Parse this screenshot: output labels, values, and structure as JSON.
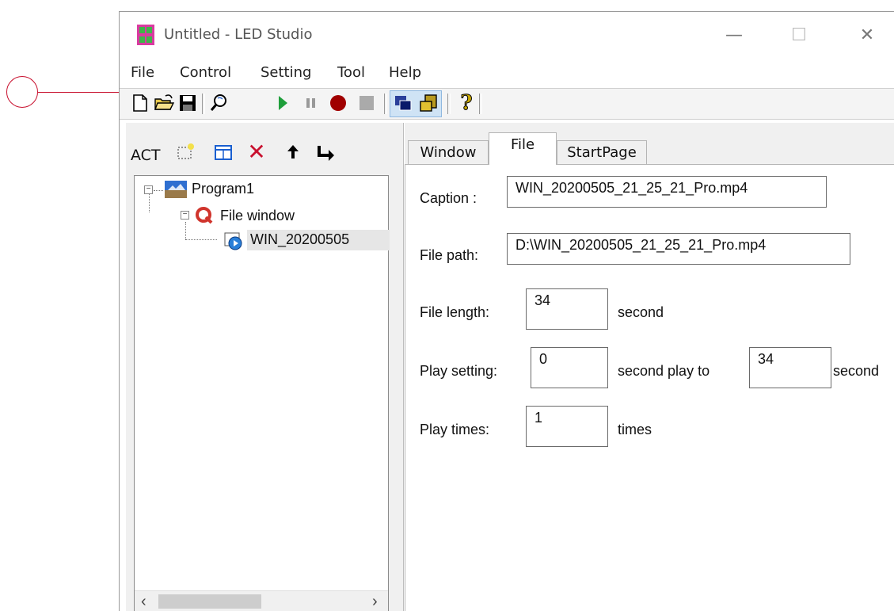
{
  "window": {
    "title": "Untitled - LED Studio",
    "min_glyph": "—",
    "max_glyph": "☐",
    "close_glyph": "✕"
  },
  "menu": [
    "File",
    "Control",
    "Setting",
    "Tool",
    "Help"
  ],
  "toolbar": {
    "icons": [
      "new-file-icon",
      "open-folder-icon",
      "save-icon",
      "preview-icon",
      "play-icon",
      "pause-icon",
      "record-icon",
      "stop-icon",
      "window-mode-icon",
      "sync-mode-icon",
      "help-icon"
    ],
    "help_glyph": "?"
  },
  "left_pane": {
    "act_label": "ACT",
    "tools": [
      "add-program-icon",
      "add-window-icon",
      "delete-icon",
      "move-up-icon",
      "move-down-icon"
    ],
    "delete_glyph": "✕",
    "up_glyph": "➜",
    "down_glyph": "↵",
    "tree": {
      "program": "Program1",
      "window": "File window",
      "file": "WIN_20200505"
    }
  },
  "tabs": [
    "Window",
    "File",
    "StartPage"
  ],
  "active_tab": "File",
  "form": {
    "caption_label": "Caption :",
    "caption_value": "WIN_20200505_21_25_21_Pro.mp4",
    "path_label": "File path:",
    "path_value": "D:\\WIN_20200505_21_25_21_Pro.mp4",
    "length_label": "File length:",
    "length_value": "34",
    "length_unit": "second",
    "play_label": "Play setting:",
    "play_from": "0",
    "play_mid": "second play to",
    "play_to": "34",
    "play_unit": "second",
    "times_label": "Play times:",
    "times_value": "1",
    "times_unit": "times"
  },
  "scroll": {
    "left": "‹",
    "right": "›"
  },
  "colors": {
    "annotation": "#c8102e",
    "play": "#1e9e3a",
    "record": "#a00000",
    "tree_select": "#e6e6e6"
  }
}
